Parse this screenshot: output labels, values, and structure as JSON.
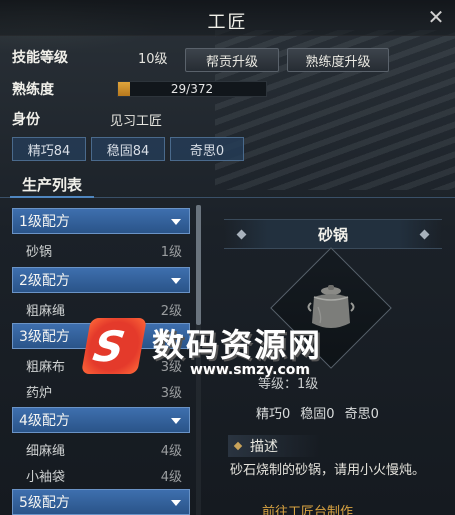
{
  "window": {
    "title": "工匠",
    "close_icon": "close-icon"
  },
  "info": {
    "skill_level_label": "技能等级",
    "skill_level_value": "10级",
    "btn_help_upgrade": "帮贡升级",
    "btn_prof_upgrade": "熟练度升级",
    "proficiency_label": "熟练度",
    "proficiency_text": "29/372",
    "proficiency_fraction": 0.078,
    "identity_label": "身份",
    "identity_value": "见习工匠",
    "stats": [
      "精巧84",
      "稳固84",
      "奇思0"
    ]
  },
  "tabs": {
    "active": "生产列表"
  },
  "list": {
    "categories": [
      {
        "label": "1级配方",
        "items": [
          {
            "name": "砂锅",
            "level": "1级"
          }
        ]
      },
      {
        "label": "2级配方",
        "items": [
          {
            "name": "粗麻绳",
            "level": "2级"
          }
        ]
      },
      {
        "label": "3级配方",
        "items": [
          {
            "name": "粗麻布",
            "level": "3级"
          },
          {
            "name": "药炉",
            "level": "3级"
          }
        ]
      },
      {
        "label": "4级配方",
        "items": [
          {
            "name": "细麻绳",
            "level": "4级"
          },
          {
            "name": "小袖袋",
            "level": "4级"
          }
        ]
      },
      {
        "label": "5级配方",
        "items": []
      }
    ]
  },
  "detail": {
    "title": "砂锅",
    "level_text": "等级：1级",
    "stats": [
      "精巧0",
      "稳固0",
      "奇思0"
    ],
    "desc_head": "描述",
    "desc_text": "砂石烧制的砂锅，请用小火慢炖。",
    "goto_link": "前往工匠台制作"
  },
  "watermark": {
    "cn": "数码资源网",
    "url": "www.smzy.com",
    "logo_letter": "S"
  },
  "colors": {
    "accent_blue": "#3e6fae",
    "xp_gold": "#e0a53c",
    "link_gold": "#d9a341"
  }
}
